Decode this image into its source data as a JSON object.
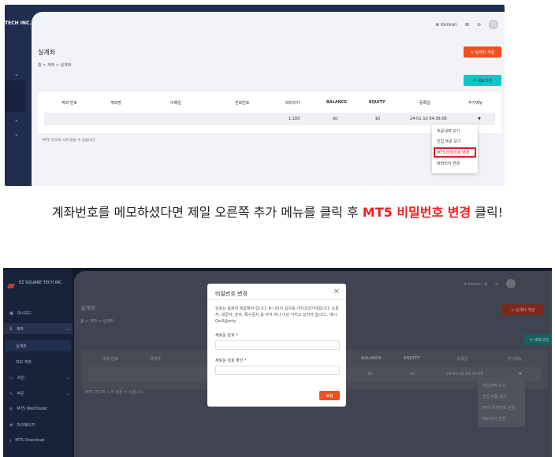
{
  "shot1": {
    "brand": "TECH INC.",
    "toolbar": {
      "language": "⊕ Korean",
      "icon_a": "⊞",
      "icon_b": "⊘"
    },
    "page_title": "실계좌",
    "breadcrumb": "홈 > 계좌 > 실계좌",
    "open_account_button": "+ 실계좌 개설",
    "refresh_button": "⟳ 새로고침",
    "columns": [
      "계좌 번호",
      "계좌명",
      "이메일",
      "전화번호",
      "레버리지",
      "BALANCE",
      "EQUITY",
      "등록일",
      "추가메뉴"
    ],
    "row": {
      "leverage": "1:100",
      "balance": "$0",
      "equity": "$0",
      "registered": "24-01-10 04:36:08",
      "more": "▼"
    },
    "note": "MT5 연고좌 시까 정용 수 있습니다.",
    "menu": [
      "주문내역 보기",
      "진입 주문 보기",
      "MT5 비밀번호 변경",
      "레버리지 변경"
    ],
    "highlighted_menu_index": 2,
    "colors": {
      "accent_orange": "#f04e23",
      "accent_teal": "#14c3c8",
      "highlight_red": "#e5182a"
    }
  },
  "caption": {
    "before": "계좌번호를 메모하셨다면 제일 오른쪽 추가 메뉴를 클릭 후 ",
    "highlight": "MT5 비밀번호 변경",
    "after": " 클릭!"
  },
  "shot2": {
    "brand": "EZ SQUARE TECH INC.",
    "sidebar": [
      {
        "icon": "▦",
        "label": "대시보드"
      },
      {
        "icon": "♀",
        "label": "계좌",
        "chev": "⌄"
      },
      {
        "icon": "",
        "label": "실계좌"
      },
      {
        "icon": "",
        "label": "데모 계좌"
      },
      {
        "icon": "▭",
        "label": "회원",
        "chev": "⌄"
      },
      {
        "icon": "∿",
        "label": "주문",
        "chev": "⌄"
      },
      {
        "icon": "◎",
        "label": "MT5 WebTrader"
      },
      {
        "icon": "⚙",
        "label": "마이페이지"
      },
      {
        "icon": "⤓",
        "label": "MT5 Download"
      }
    ],
    "toolbar": {
      "language": "⊕ Korean",
      "icon_a": "⊞",
      "icon_b": "⊘"
    },
    "page_title": "실계좌",
    "breadcrumb": "홈 > 계좌 > 실계좌",
    "open_account_button": "+ 실계좌 개설",
    "refresh_button": "⟳ 새로고침",
    "columns": [
      "계좌 번호",
      "계좌명",
      "BALANCE",
      "EQUITY",
      "등록일",
      "추가메뉴"
    ],
    "row": {
      "balance": "$0",
      "equity": "$0",
      "registered": "24-01-10 04:36:08",
      "more": "▼"
    },
    "note": "MT5 연고좌 시까 정용 수 있습니다.",
    "menu": [
      "주문내역 보기",
      "진입 주문 보기",
      "MT5 비밀번호 변경",
      "레버리지 변경"
    ],
    "modal": {
      "title": "비밀번호 변경",
      "close": "✕",
      "description": "암호는 충분히 복잡해야 합니다. 8~20의 길이를 가지고있어야합니다. 소문자, 대문자, 숫자, 특수문자 를 각각 하나 이상 가지고 있어야 합니다.. 예시: Qw3@erty",
      "new_password_label": "새로운 암호 *",
      "new_password_value": "",
      "confirm_password_label": "새로운 암호 확인 *",
      "confirm_password_value": "",
      "submit_button": "요청"
    }
  }
}
